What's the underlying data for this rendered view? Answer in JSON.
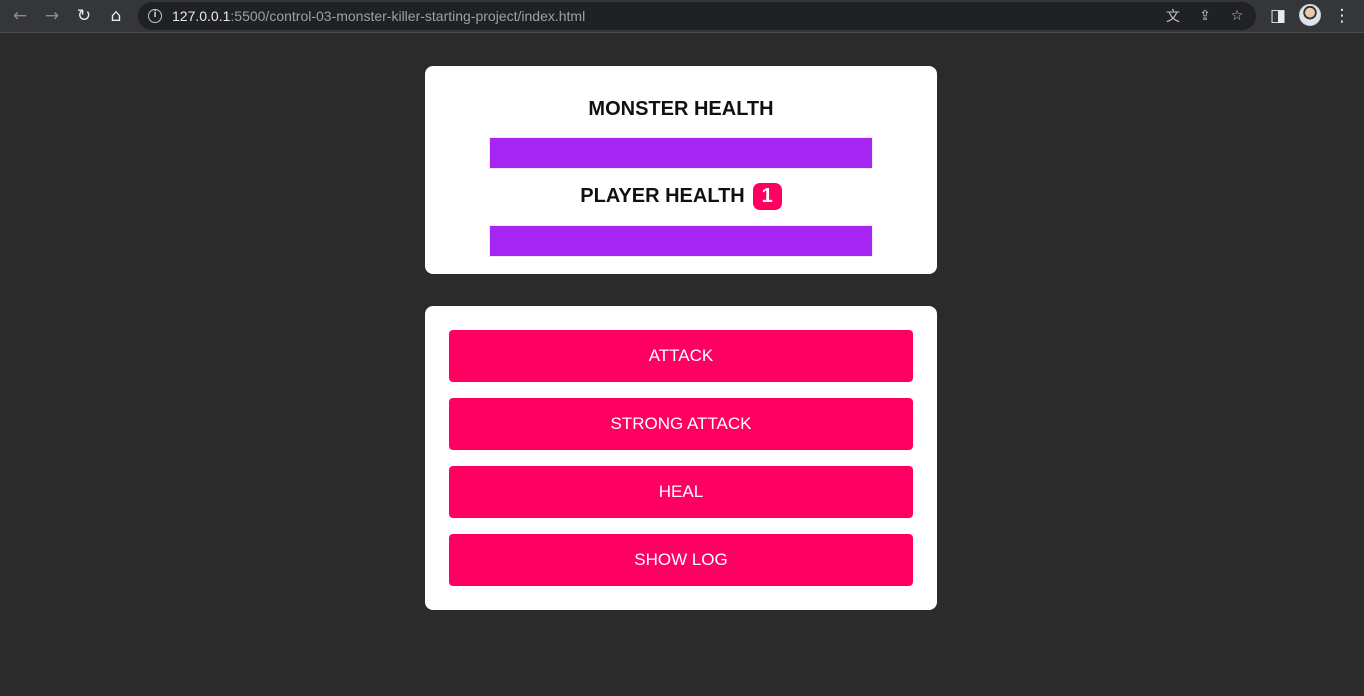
{
  "browser": {
    "url_host": "127.0.0.1",
    "url_rest": ":5500/control-03-monster-killer-starting-project/index.html"
  },
  "health": {
    "monster_label": "MONSTER HEALTH",
    "monster_value_fraction": 1.0,
    "player_label": "PLAYER HEALTH",
    "player_value_fraction": 1.0,
    "bonus_life": "1"
  },
  "controls": {
    "attack": "ATTACK",
    "strong_attack": "STRONG ATTACK",
    "heal": "HEAL",
    "show_log": "SHOW LOG"
  },
  "colors": {
    "page_background": "#2b2b2b",
    "card_background": "#ffffff",
    "button_accent": "#ff0062",
    "health_bar": "#a826f3"
  }
}
